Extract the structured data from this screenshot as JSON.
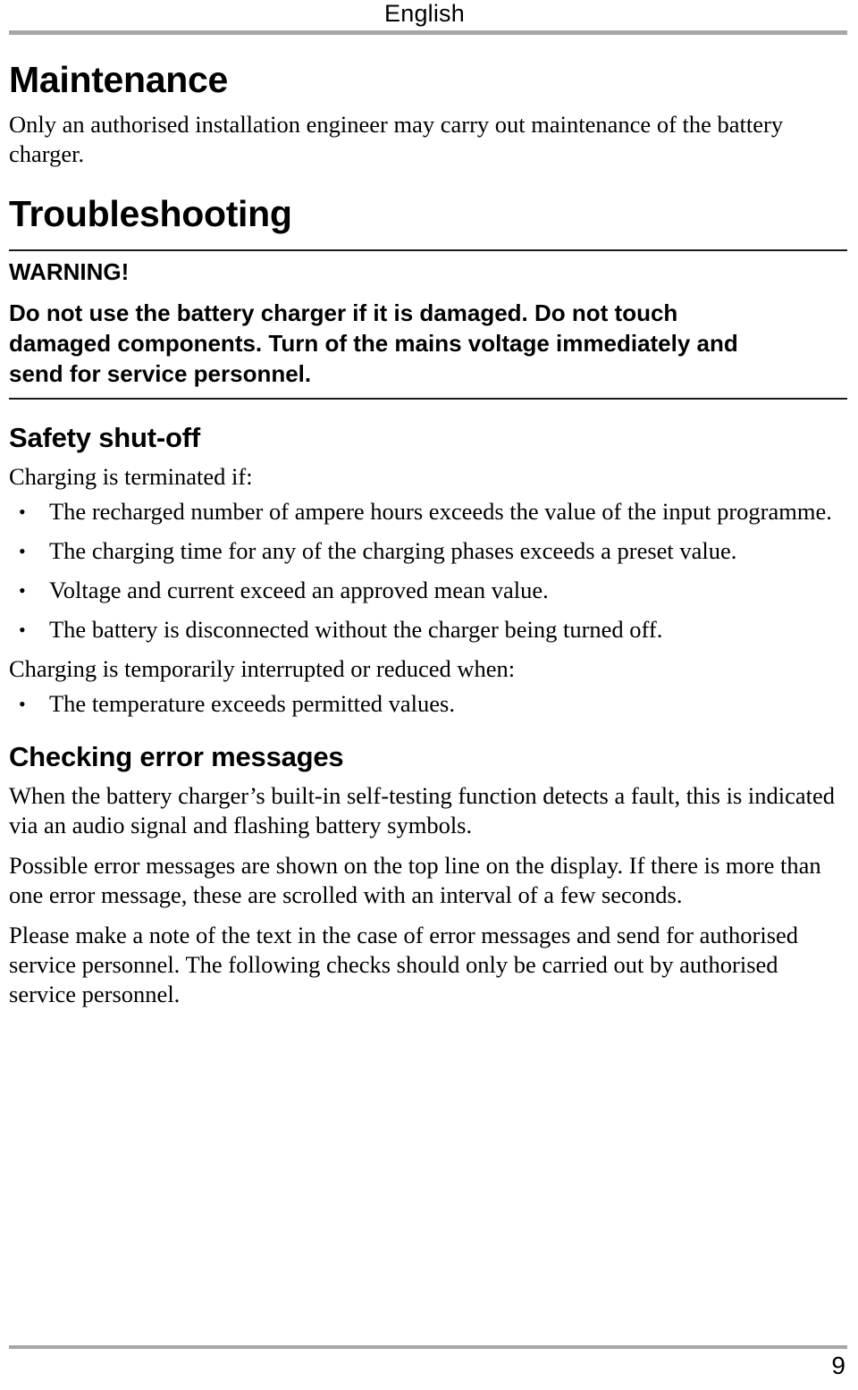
{
  "header": {
    "title": "English",
    "rule_color": "#a7a7a7"
  },
  "sections": {
    "maintenance": {
      "heading": "Maintenance",
      "paragraph": "Only an authorised installation engineer may carry out maintenance of the battery charger."
    },
    "troubleshooting": {
      "heading": "Troubleshooting",
      "warning": {
        "title": "WARNING!",
        "text": "Do not use the battery charger if it is damaged.  Do not touch damaged components. Turn of the mains voltage immediately and send for service personnel."
      }
    },
    "safety_shutoff": {
      "heading": "Safety shut-off",
      "intro_terminated": "Charging is terminated if:",
      "bullets_terminated": [
        "The recharged number of ampere hours exceeds the value of the input programme.",
        "The charging time for any of the charging phases exceeds a preset value.",
        "Voltage and current exceed an approved mean value.",
        "The battery is disconnected without the charger being turned off."
      ],
      "intro_interrupted": "Charging is temporarily interrupted or reduced when:",
      "bullets_interrupted": [
        "The temperature exceeds permitted values."
      ]
    },
    "checking_error_messages": {
      "heading": "Checking error messages",
      "paragraphs": [
        "When the battery charger’s built-in self-testing function detects a fault, this is indicated via an audio signal and flashing battery symbols.",
        "Possible error messages are shown on the top line on the display. If there is more than one error message, these are scrolled with an interval of a few seconds.",
        "Please make a note of the text in the case of error messages and send for authorised service personnel. The following checks should only be carried out by authorised service personnel."
      ]
    }
  },
  "bullet_glyph": "•",
  "footer": {
    "page_number": "9",
    "rule_color": "#a7a7a7"
  }
}
